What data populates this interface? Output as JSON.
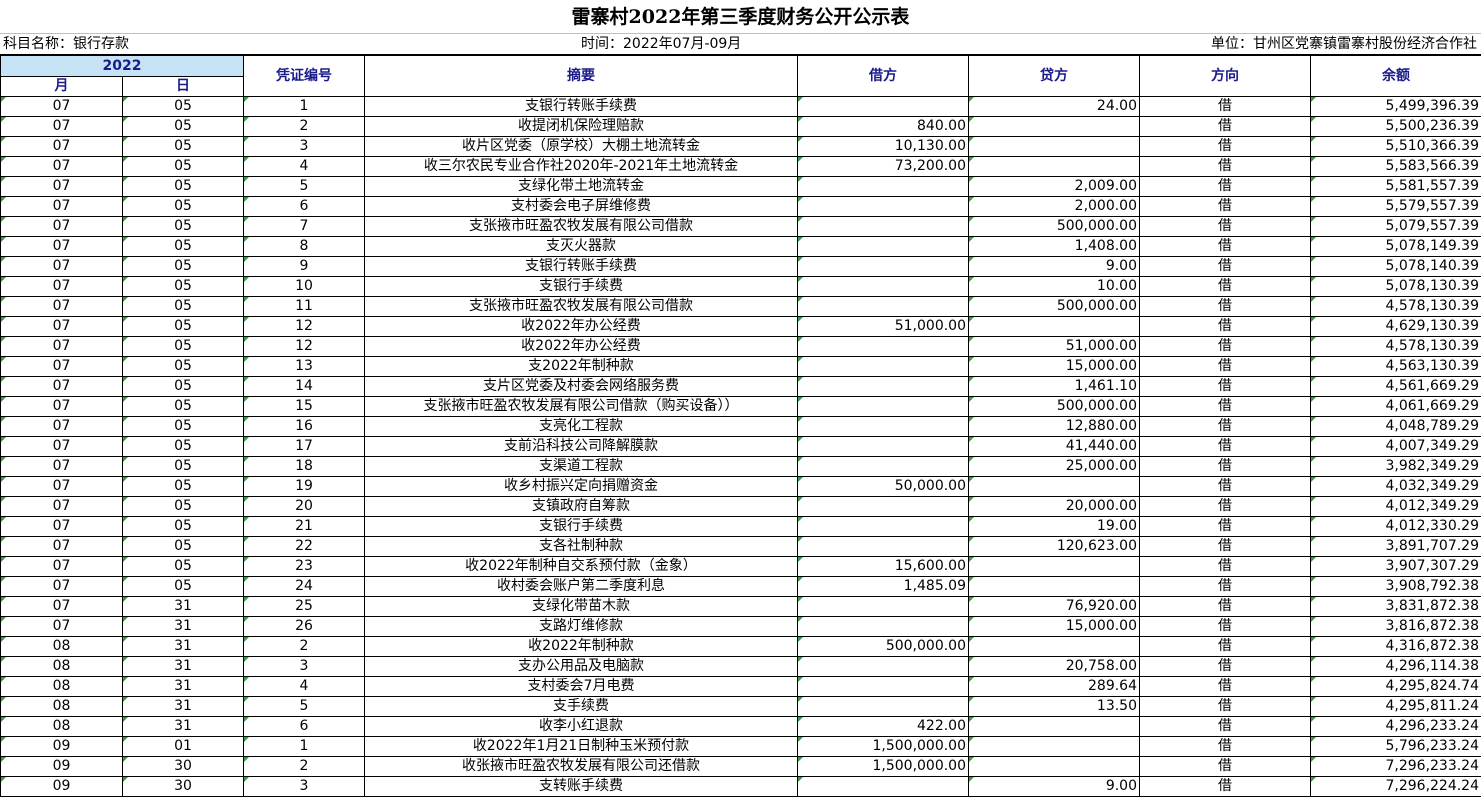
{
  "title": "雷寨村2022年第三季度财务公开公示表",
  "meta": {
    "subject": "科目名称：银行存款",
    "period": "时间：2022年07月-09月",
    "unit": "单位：甘州区党寨镇雷寨村股份经济合作社"
  },
  "headers": {
    "year": "2022",
    "month": "月",
    "day": "日",
    "voucher": "凭证编号",
    "summary": "摘要",
    "debit": "借方",
    "credit": "贷方",
    "direction": "方向",
    "balance": "余额"
  },
  "rows": [
    {
      "m": "07",
      "d": "05",
      "v": "1",
      "s": "支银行转账手续费",
      "debit": "",
      "credit": "24.00",
      "dir": "借",
      "bal": "5,499,396.39"
    },
    {
      "m": "07",
      "d": "05",
      "v": "2",
      "s": "收提闭机保险理赔款",
      "debit": "840.00",
      "credit": "",
      "dir": "借",
      "bal": "5,500,236.39"
    },
    {
      "m": "07",
      "d": "05",
      "v": "3",
      "s": "收片区党委（原学校）大棚土地流转金",
      "debit": "10,130.00",
      "credit": "",
      "dir": "借",
      "bal": "5,510,366.39"
    },
    {
      "m": "07",
      "d": "05",
      "v": "4",
      "s": "收三尔农民专业合作社2020年-2021年土地流转金",
      "debit": "73,200.00",
      "credit": "",
      "dir": "借",
      "bal": "5,583,566.39"
    },
    {
      "m": "07",
      "d": "05",
      "v": "5",
      "s": "支绿化带土地流转金",
      "debit": "",
      "credit": "2,009.00",
      "dir": "借",
      "bal": "5,581,557.39"
    },
    {
      "m": "07",
      "d": "05",
      "v": "6",
      "s": "支村委会电子屏维修费",
      "debit": "",
      "credit": "2,000.00",
      "dir": "借",
      "bal": "5,579,557.39"
    },
    {
      "m": "07",
      "d": "05",
      "v": "7",
      "s": "支张掖市旺盈农牧发展有限公司借款",
      "debit": "",
      "credit": "500,000.00",
      "dir": "借",
      "bal": "5,079,557.39"
    },
    {
      "m": "07",
      "d": "05",
      "v": "8",
      "s": "支灭火器款",
      "debit": "",
      "credit": "1,408.00",
      "dir": "借",
      "bal": "5,078,149.39"
    },
    {
      "m": "07",
      "d": "05",
      "v": "9",
      "s": "支银行转账手续费",
      "debit": "",
      "credit": "9.00",
      "dir": "借",
      "bal": "5,078,140.39"
    },
    {
      "m": "07",
      "d": "05",
      "v": "10",
      "s": "支银行手续费",
      "debit": "",
      "credit": "10.00",
      "dir": "借",
      "bal": "5,078,130.39"
    },
    {
      "m": "07",
      "d": "05",
      "v": "11",
      "s": "支张掖市旺盈农牧发展有限公司借款",
      "debit": "",
      "credit": "500,000.00",
      "dir": "借",
      "bal": "4,578,130.39"
    },
    {
      "m": "07",
      "d": "05",
      "v": "12",
      "s": "收2022年办公经费",
      "debit": "51,000.00",
      "credit": "",
      "dir": "借",
      "bal": "4,629,130.39"
    },
    {
      "m": "07",
      "d": "05",
      "v": "12",
      "s": "收2022年办公经费",
      "debit": "",
      "credit": "51,000.00",
      "dir": "借",
      "bal": "4,578,130.39"
    },
    {
      "m": "07",
      "d": "05",
      "v": "13",
      "s": "支2022年制种款",
      "debit": "",
      "credit": "15,000.00",
      "dir": "借",
      "bal": "4,563,130.39"
    },
    {
      "m": "07",
      "d": "05",
      "v": "14",
      "s": "支片区党委及村委会网络服务费",
      "debit": "",
      "credit": "1,461.10",
      "dir": "借",
      "bal": "4,561,669.29"
    },
    {
      "m": "07",
      "d": "05",
      "v": "15",
      "s": "支张掖市旺盈农牧发展有限公司借款（购买设备））",
      "debit": "",
      "credit": "500,000.00",
      "dir": "借",
      "bal": "4,061,669.29"
    },
    {
      "m": "07",
      "d": "05",
      "v": "16",
      "s": "支亮化工程款",
      "debit": "",
      "credit": "12,880.00",
      "dir": "借",
      "bal": "4,048,789.29"
    },
    {
      "m": "07",
      "d": "05",
      "v": "17",
      "s": "支前沿科技公司降解膜款",
      "debit": "",
      "credit": "41,440.00",
      "dir": "借",
      "bal": "4,007,349.29"
    },
    {
      "m": "07",
      "d": "05",
      "v": "18",
      "s": "支渠道工程款",
      "debit": "",
      "credit": "25,000.00",
      "dir": "借",
      "bal": "3,982,349.29"
    },
    {
      "m": "07",
      "d": "05",
      "v": "19",
      "s": "收乡村振兴定向捐赠资金",
      "debit": "50,000.00",
      "credit": "",
      "dir": "借",
      "bal": "4,032,349.29"
    },
    {
      "m": "07",
      "d": "05",
      "v": "20",
      "s": "支镇政府自筹款",
      "debit": "",
      "credit": "20,000.00",
      "dir": "借",
      "bal": "4,012,349.29"
    },
    {
      "m": "07",
      "d": "05",
      "v": "21",
      "s": "支银行手续费",
      "debit": "",
      "credit": "19.00",
      "dir": "借",
      "bal": "4,012,330.29"
    },
    {
      "m": "07",
      "d": "05",
      "v": "22",
      "s": "支各社制种款",
      "debit": "",
      "credit": "120,623.00",
      "dir": "借",
      "bal": "3,891,707.29"
    },
    {
      "m": "07",
      "d": "05",
      "v": "23",
      "s": "收2022年制种自交系预付款（金象）",
      "debit": "15,600.00",
      "credit": "",
      "dir": "借",
      "bal": "3,907,307.29"
    },
    {
      "m": "07",
      "d": "05",
      "v": "24",
      "s": "收村委会账户第二季度利息",
      "debit": "1,485.09",
      "credit": "",
      "dir": "借",
      "bal": "3,908,792.38"
    },
    {
      "m": "07",
      "d": "31",
      "v": "25",
      "s": "支绿化带苗木款",
      "debit": "",
      "credit": "76,920.00",
      "dir": "借",
      "bal": "3,831,872.38"
    },
    {
      "m": "07",
      "d": "31",
      "v": "26",
      "s": "支路灯维修款",
      "debit": "",
      "credit": "15,000.00",
      "dir": "借",
      "bal": "3,816,872.38"
    },
    {
      "m": "08",
      "d": "31",
      "v": "2",
      "s": "收2022年制种款",
      "debit": "500,000.00",
      "credit": "",
      "dir": "借",
      "bal": "4,316,872.38"
    },
    {
      "m": "08",
      "d": "31",
      "v": "3",
      "s": "支办公用品及电脑款",
      "debit": "",
      "credit": "20,758.00",
      "dir": "借",
      "bal": "4,296,114.38"
    },
    {
      "m": "08",
      "d": "31",
      "v": "4",
      "s": "支村委会7月电费",
      "debit": "",
      "credit": "289.64",
      "dir": "借",
      "bal": "4,295,824.74"
    },
    {
      "m": "08",
      "d": "31",
      "v": "5",
      "s": "支手续费",
      "debit": "",
      "credit": "13.50",
      "dir": "借",
      "bal": "4,295,811.24"
    },
    {
      "m": "08",
      "d": "31",
      "v": "6",
      "s": "收李小红退款",
      "debit": "422.00",
      "credit": "",
      "dir": "借",
      "bal": "4,296,233.24"
    },
    {
      "m": "09",
      "d": "01",
      "v": "1",
      "s": "收2022年1月21日制种玉米预付款",
      "debit": "1,500,000.00",
      "credit": "",
      "dir": "借",
      "bal": "5,796,233.24"
    },
    {
      "m": "09",
      "d": "30",
      "v": "2",
      "s": "收张掖市旺盈农牧发展有限公司还借款",
      "debit": "1,500,000.00",
      "credit": "",
      "dir": "借",
      "bal": "7,296,233.24"
    },
    {
      "m": "09",
      "d": "30",
      "v": "3",
      "s": "支转账手续费",
      "debit": "",
      "credit": "9.00",
      "dir": "借",
      "bal": "7,296,224.24"
    }
  ]
}
